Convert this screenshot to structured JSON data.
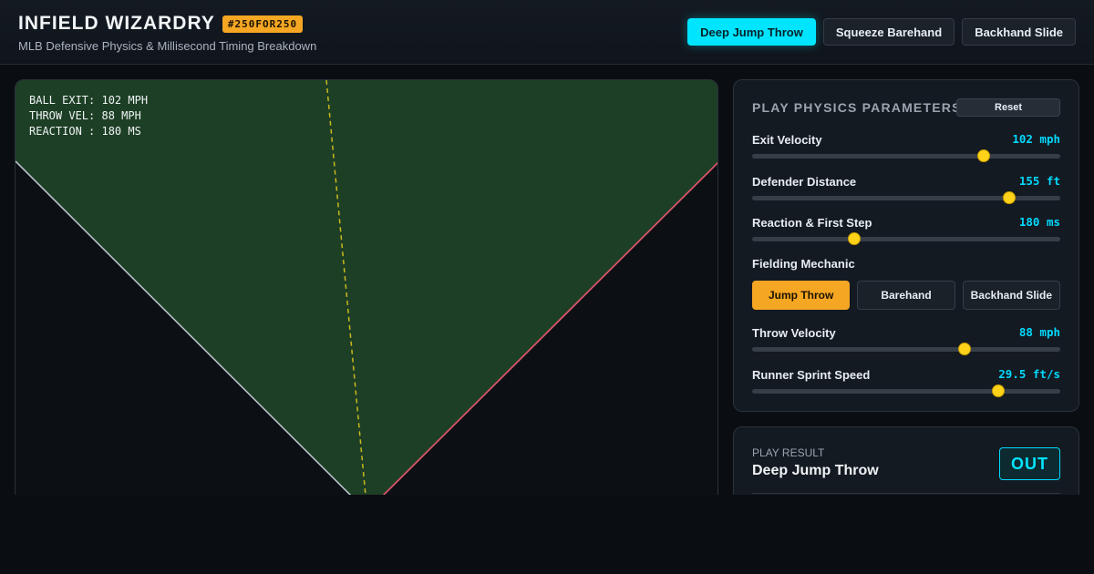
{
  "header": {
    "title": "INFIELD WIZARDRY",
    "badge": "#250FOR250",
    "subtitle": "MLB Defensive Physics & Millisecond Timing Breakdown",
    "presets": [
      {
        "label": "Deep Jump Throw",
        "active": true
      },
      {
        "label": "Squeeze Barehand",
        "active": false
      },
      {
        "label": "Backhand Slide",
        "active": false
      }
    ]
  },
  "field": {
    "readout": [
      "BALL EXIT: 102 MPH",
      "THROW VEL: 88 MPH",
      "REACTION : 180 MS"
    ],
    "colors": {
      "grass": "#1d3f25",
      "foul_line": "#b7c1c8",
      "throw_line": "#d9546a",
      "ball_path": "#c9b820",
      "dirt": "#0c1014"
    }
  },
  "params": {
    "title": "PLAY PHYSICS PARAMETERS",
    "reset_label": "Reset",
    "sliders": [
      {
        "label": "Exit Velocity",
        "value": "102 mph",
        "fraction": 0.75
      },
      {
        "label": "Defender Distance",
        "value": "155 ft",
        "fraction": 0.833
      },
      {
        "label": "Reaction & First Step",
        "value": "180 ms",
        "fraction": 0.33
      }
    ],
    "mechanic_label": "Fielding Mechanic",
    "mechanics": [
      {
        "label": "Jump Throw",
        "active": true
      },
      {
        "label": "Barehand",
        "active": false
      },
      {
        "label": "Backhand Slide",
        "active": false
      }
    ],
    "sliders2": [
      {
        "label": "Throw Velocity",
        "value": "88 mph",
        "fraction": 0.688
      },
      {
        "label": "Runner Sprint Speed",
        "value": "29.5 ft/s",
        "fraction": 0.8
      }
    ]
  },
  "result": {
    "label": "PLAY RESULT",
    "play": "Deep Jump Throw",
    "outcome": "OUT"
  },
  "colors": {
    "accent": "#00e5ff",
    "highlight": "#f5a623",
    "value_text": "#00d9ff",
    "thumb": "#ffd21a"
  }
}
